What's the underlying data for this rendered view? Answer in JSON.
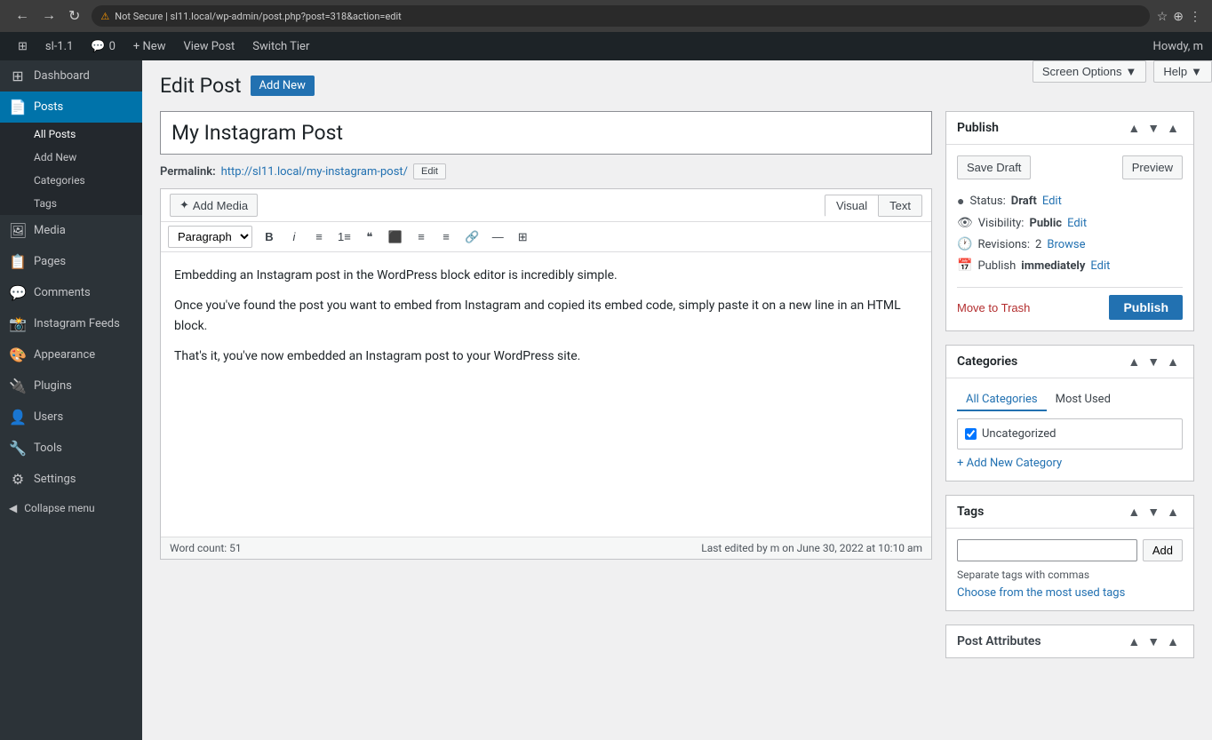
{
  "browser": {
    "url": "sl11.local/wp-admin/post.php?post=318&action=edit",
    "protocol": "Not Secure",
    "back_tooltip": "Go back",
    "forward_tooltip": "Go forward",
    "refresh_tooltip": "Reload page"
  },
  "admin_bar": {
    "wp_logo": "⊞",
    "site_name": "sl-1.1",
    "comments_label": "0",
    "new_label": "+ New",
    "view_post_label": "View Post",
    "switch_tier_label": "Switch Tier",
    "howdy_label": "Howdy, m"
  },
  "sidebar": {
    "dashboard_label": "Dashboard",
    "posts_label": "Posts",
    "all_posts_label": "All Posts",
    "add_new_label": "Add New",
    "categories_label": "Categories",
    "tags_label": "Tags",
    "media_label": "Media",
    "pages_label": "Pages",
    "comments_label": "Comments",
    "instagram_feeds_label": "Instagram Feeds",
    "appearance_label": "Appearance",
    "plugins_label": "Plugins",
    "users_label": "Users",
    "tools_label": "Tools",
    "settings_label": "Settings",
    "collapse_menu_label": "Collapse menu"
  },
  "header": {
    "page_title": "Edit Post",
    "add_new_btn": "Add New",
    "screen_options_btn": "Screen Options",
    "help_btn": "Help"
  },
  "post": {
    "title": "My Instagram Post",
    "permalink_label": "Permalink:",
    "permalink_url": "http://sl11.local/my-instagram-post/",
    "permalink_edit_btn": "Edit",
    "content_p1": "Embedding an Instagram post in the WordPress block editor is incredibly simple.",
    "content_p2": "Once you've found the post you want to embed from Instagram and copied its embed code, simply paste it on a new line in an HTML block.",
    "content_p3": "That's it, you've now embedded an Instagram post to your WordPress site.",
    "word_count_label": "Word count: 51",
    "last_edited_label": "Last edited by m on June 30, 2022 at 10:10 am",
    "paragraph_option": "Paragraph",
    "editor_tab_visual": "Visual",
    "editor_tab_text": "Text",
    "add_media_btn": "Add Media"
  },
  "publish_box": {
    "title": "Publish",
    "save_draft_btn": "Save Draft",
    "preview_btn": "Preview",
    "status_label": "Status:",
    "status_value": "Draft",
    "status_edit_link": "Edit",
    "visibility_label": "Visibility:",
    "visibility_value": "Public",
    "visibility_edit_link": "Edit",
    "revisions_label": "Revisions:",
    "revisions_value": "2",
    "revisions_browse_link": "Browse",
    "publish_label": "Publish",
    "publish_timing": "immediately",
    "publish_timing_edit": "Edit",
    "move_to_trash": "Move to Trash",
    "publish_btn": "Publish"
  },
  "categories_box": {
    "title": "Categories",
    "tab_all": "All Categories",
    "tab_most_used": "Most Used",
    "uncategorized_label": "Uncategorized",
    "uncategorized_checked": true,
    "add_category_link": "+ Add New Category"
  },
  "tags_box": {
    "title": "Tags",
    "input_placeholder": "",
    "add_btn": "Add",
    "separate_note": "Separate tags with commas",
    "choose_tags_link": "Choose from the most used tags"
  },
  "post_attributes_box": {
    "title": "Post Attributes"
  },
  "icons": {
    "wp_logo": "⊞",
    "pencil_icon": "✏",
    "status_icon": "●",
    "visibility_icon": "👁",
    "revisions_icon": "🕐",
    "calendar_icon": "📅",
    "chevron_up": "▲",
    "chevron_down": "▼",
    "collapse_icon": "◀"
  }
}
